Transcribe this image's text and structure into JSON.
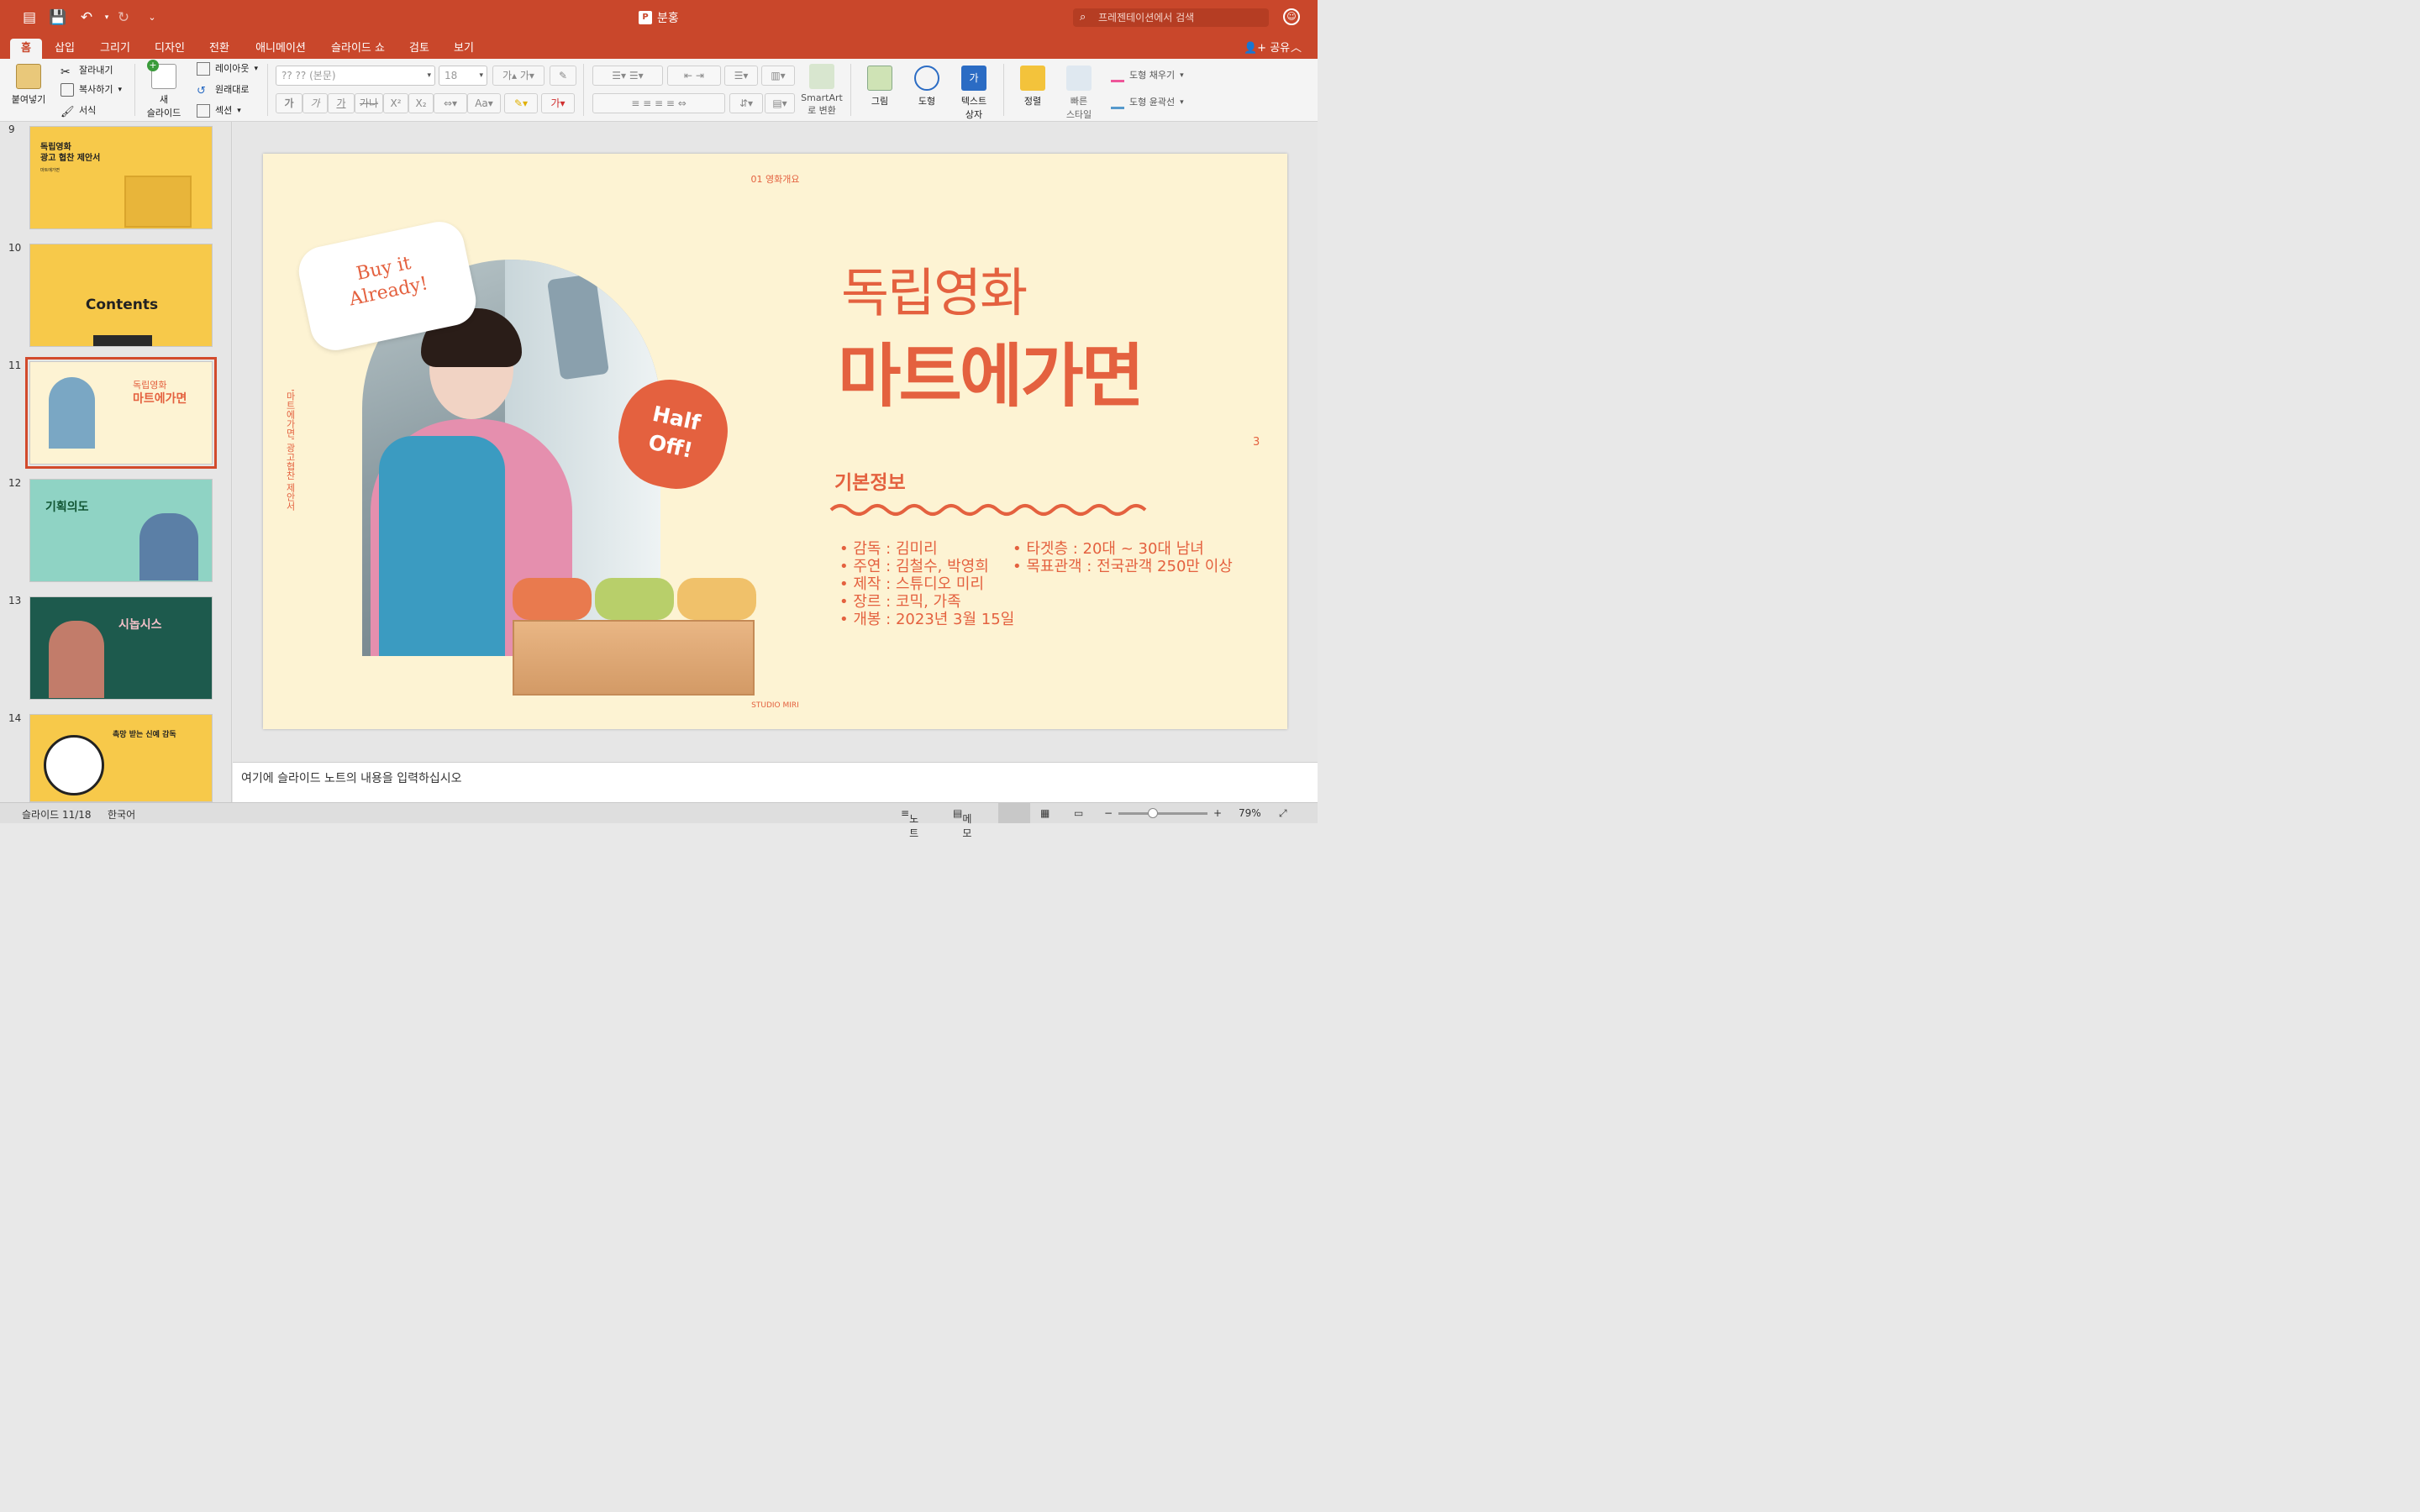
{
  "titlebar": {
    "title": "분홍",
    "search_placeholder": "프레젠테이션에서 검색"
  },
  "tabs": [
    "홈",
    "삽입",
    "그리기",
    "디자인",
    "전환",
    "애니메이션",
    "슬라이드 쇼",
    "검토",
    "보기"
  ],
  "share_label": "공유",
  "ribbon": {
    "paste": "붙여넣기",
    "cut": "잘라내기",
    "copy": "복사하기",
    "format": "서식",
    "new_slide_1": "새",
    "new_slide_2": "슬라이드",
    "layout": "레이아웃",
    "reset": "원래대로",
    "section": "섹션",
    "font_name": "?? ?? (본문)",
    "font_size": "18",
    "smartart_1": "SmartArt",
    "smartart_2": "로 변환",
    "picture": "그림",
    "shape": "도형",
    "textbox_1": "텍스트",
    "textbox_2": "상자",
    "arrange": "정렬",
    "quick_style_1": "빠른",
    "quick_style_2": "스타일",
    "shape_fill": "도형 채우기",
    "shape_outline": "도형 윤곽선",
    "bold_k": "가",
    "italic_k": "가",
    "underline_k": "가",
    "strike_k": "가나"
  },
  "thumbnails": [
    {
      "num": "9",
      "title_1": "독립영화",
      "title_2": "광고 협찬 제안서",
      "sub": "마트에가면",
      "bg": "#f7c94a"
    },
    {
      "num": "10",
      "title": "Contents",
      "bg": "#f7c94a"
    },
    {
      "num": "11",
      "title_1": "독립영화",
      "title_2": "마트에가면",
      "bg": "#fdf3d3",
      "selected": true
    },
    {
      "num": "12",
      "title": "기획의도",
      "bg": "#8fd3c4"
    },
    {
      "num": "13",
      "title": "시놉시스",
      "bg": "#1d5a4d"
    },
    {
      "num": "14",
      "title": "촉망 받는 신예 감독",
      "bg": "#f7c94a"
    }
  ],
  "slide": {
    "section_label": "01 영화개요",
    "side_text": "'마트에가면' 광고협찬 제안서",
    "title_small": "독립영화",
    "title_big": "마트에가면",
    "page_num": "3",
    "info_heading": "기본정보",
    "info_left": [
      "감독 : 김미리",
      "주연 : 김철수, 박영희",
      "제작 : 스튜디오 미리",
      "장르 : 코믹, 가족",
      "개봉 : 2023년 3월 15일"
    ],
    "info_right": [
      "타겟층 : 20대 ~ 30대 남녀",
      "목표관객 : 전국관객 250만 이상"
    ],
    "sticker_1_line1": "Buy it",
    "sticker_1_line2": "Already!",
    "sticker_2_line1": "Half",
    "sticker_2_line2": "Off!",
    "footer": "STUDIO MIRI",
    "accent": "#e4613f"
  },
  "notes_placeholder": "여기에 슬라이드 노트의 내용을 입력하십시오",
  "status": {
    "slide": "슬라이드 11/18",
    "lang": "한국어",
    "notes": "노트",
    "comments": "메모",
    "zoom": "79%"
  }
}
